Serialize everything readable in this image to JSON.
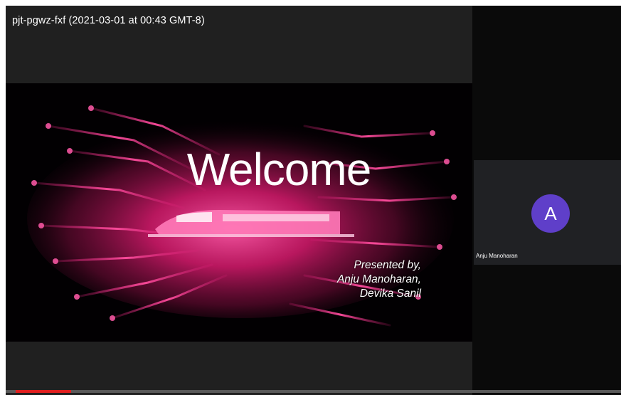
{
  "meeting": {
    "title": "pjt-pgwz-fxf (2021-03-01 at 00:43 GMT-8)"
  },
  "slide": {
    "heading": "Welcome",
    "presented_by": "Presented by,",
    "presenters": [
      "Anju Manoharan,",
      "Devika Sanil"
    ]
  },
  "participant": {
    "initial": "A",
    "name": "Anju Manoharan",
    "avatar_color": "#5f3fc9"
  },
  "playback": {
    "progress_fraction": 0.09,
    "progress_color": "#e01f1f"
  },
  "colors": {
    "slide_accent": "#e0207a",
    "bar_background": "#202020"
  }
}
